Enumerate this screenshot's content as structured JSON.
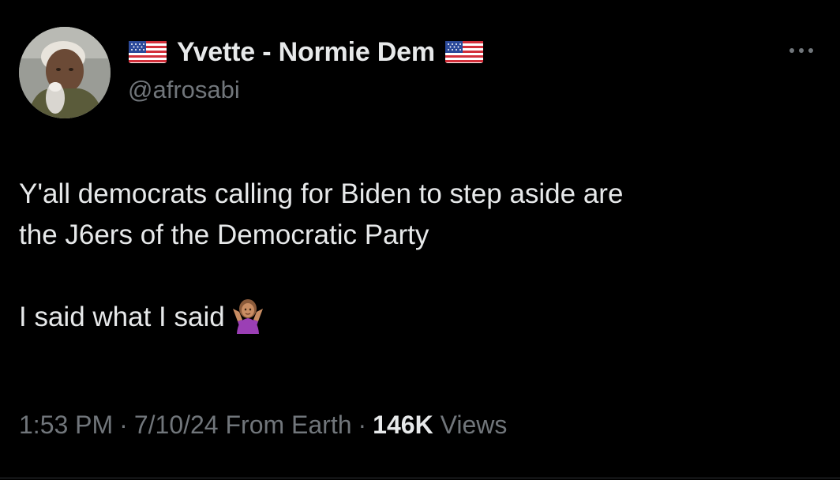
{
  "author": {
    "display_name": "Yvette - Normie Dem",
    "handle": "@afrosabi",
    "avatar": "avatar",
    "name_prefix_icon": "us-flag-icon",
    "name_suffix_icon": "us-flag-icon"
  },
  "tweet": {
    "line1": "Y'all democrats calling for Biden to step aside are",
    "line2": "the J6ers of the Democratic Party",
    "line3": "I said what I said",
    "emoji": "person-shrugging-icon"
  },
  "meta": {
    "time": "1:53 PM",
    "date": "7/10/24",
    "source": "From Earth",
    "views_count": "146K",
    "views_label": "Views",
    "separator": "·"
  },
  "menu_icon": "more-options-icon",
  "colors": {
    "background": "#000000",
    "primary_text": "#e7e9ea",
    "secondary_text": "#71767b"
  }
}
